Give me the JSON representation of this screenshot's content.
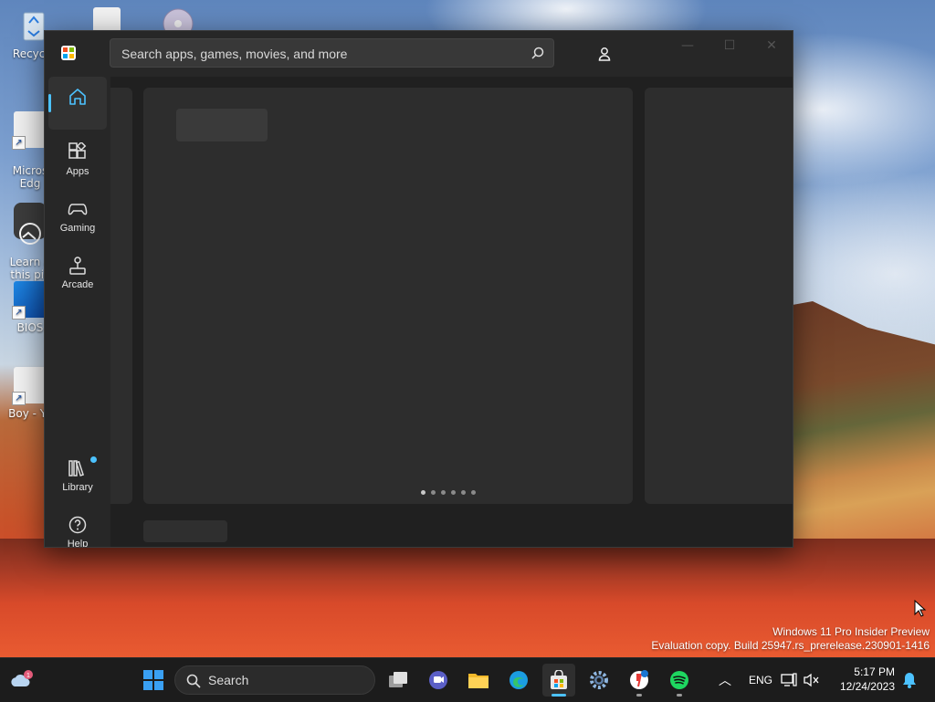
{
  "desktop": {
    "icons": [
      {
        "label": "Recycle"
      },
      {
        "label": "Micros\nEdg"
      },
      {
        "label": "Learn a\nthis pic"
      },
      {
        "label": "BIOS"
      },
      {
        "label": "Boy - Ya"
      }
    ]
  },
  "store": {
    "search": {
      "placeholder": "Search apps, games, movies, and more"
    },
    "nav": {
      "home": "",
      "apps": "Apps",
      "gaming": "Gaming",
      "arcade": "Arcade",
      "library": "Library",
      "help": "Help"
    },
    "carousel": {
      "page_count": 6,
      "active_index": 0
    }
  },
  "watermark": {
    "line1": "Windows 11 Pro Insider Preview",
    "line2": "Evaluation copy. Build 25947.rs_prerelease.230901-1416"
  },
  "taskbar": {
    "search_label": "Search",
    "weather_badge": "1",
    "language": "ENG",
    "time": "5:17 PM",
    "date": "12/24/2023"
  },
  "colors": {
    "accent": "#4cc2ff",
    "window_bg": "#272727",
    "content_bg": "#202020",
    "card_bg": "#2d2d2d"
  }
}
